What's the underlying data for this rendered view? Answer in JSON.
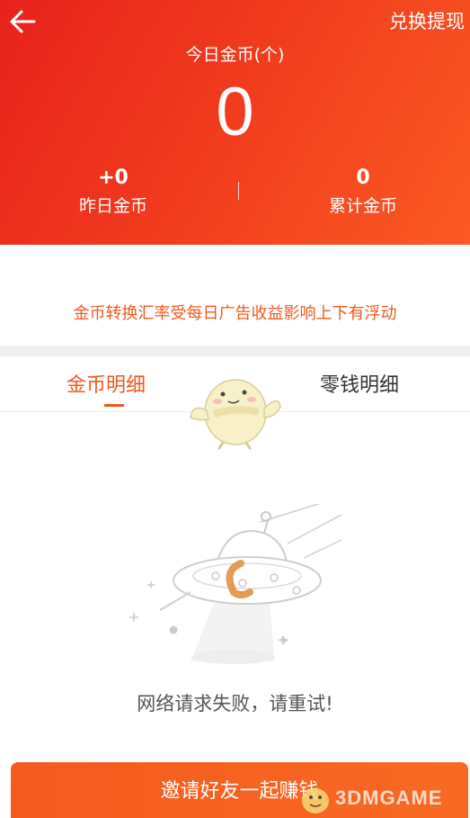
{
  "header": {
    "exchange_label": "兑换提现",
    "today_label": "今日金币(个)",
    "today_value": "0",
    "yesterday_value": "+0",
    "yesterday_label": "昨日金币",
    "total_value": "0",
    "total_label": "累计金币"
  },
  "notice": "金币转换汇率受每日广告收益影响上下有浮动",
  "tabs": [
    {
      "label": "金币明细",
      "active": true
    },
    {
      "label": "零钱明细",
      "active": false
    }
  ],
  "error_message": "网络请求失败，请重试!",
  "invite_button": "邀请好友一起赚钱",
  "watermark": "3DMGAME",
  "colors": {
    "header_gradient_start": "#e8221c",
    "header_gradient_end": "#fb5a22",
    "accent": "#f0591f"
  },
  "icons": [
    "back-arrow-icon",
    "mascot-icon",
    "ufo-illustration",
    "watermark-logo"
  ]
}
